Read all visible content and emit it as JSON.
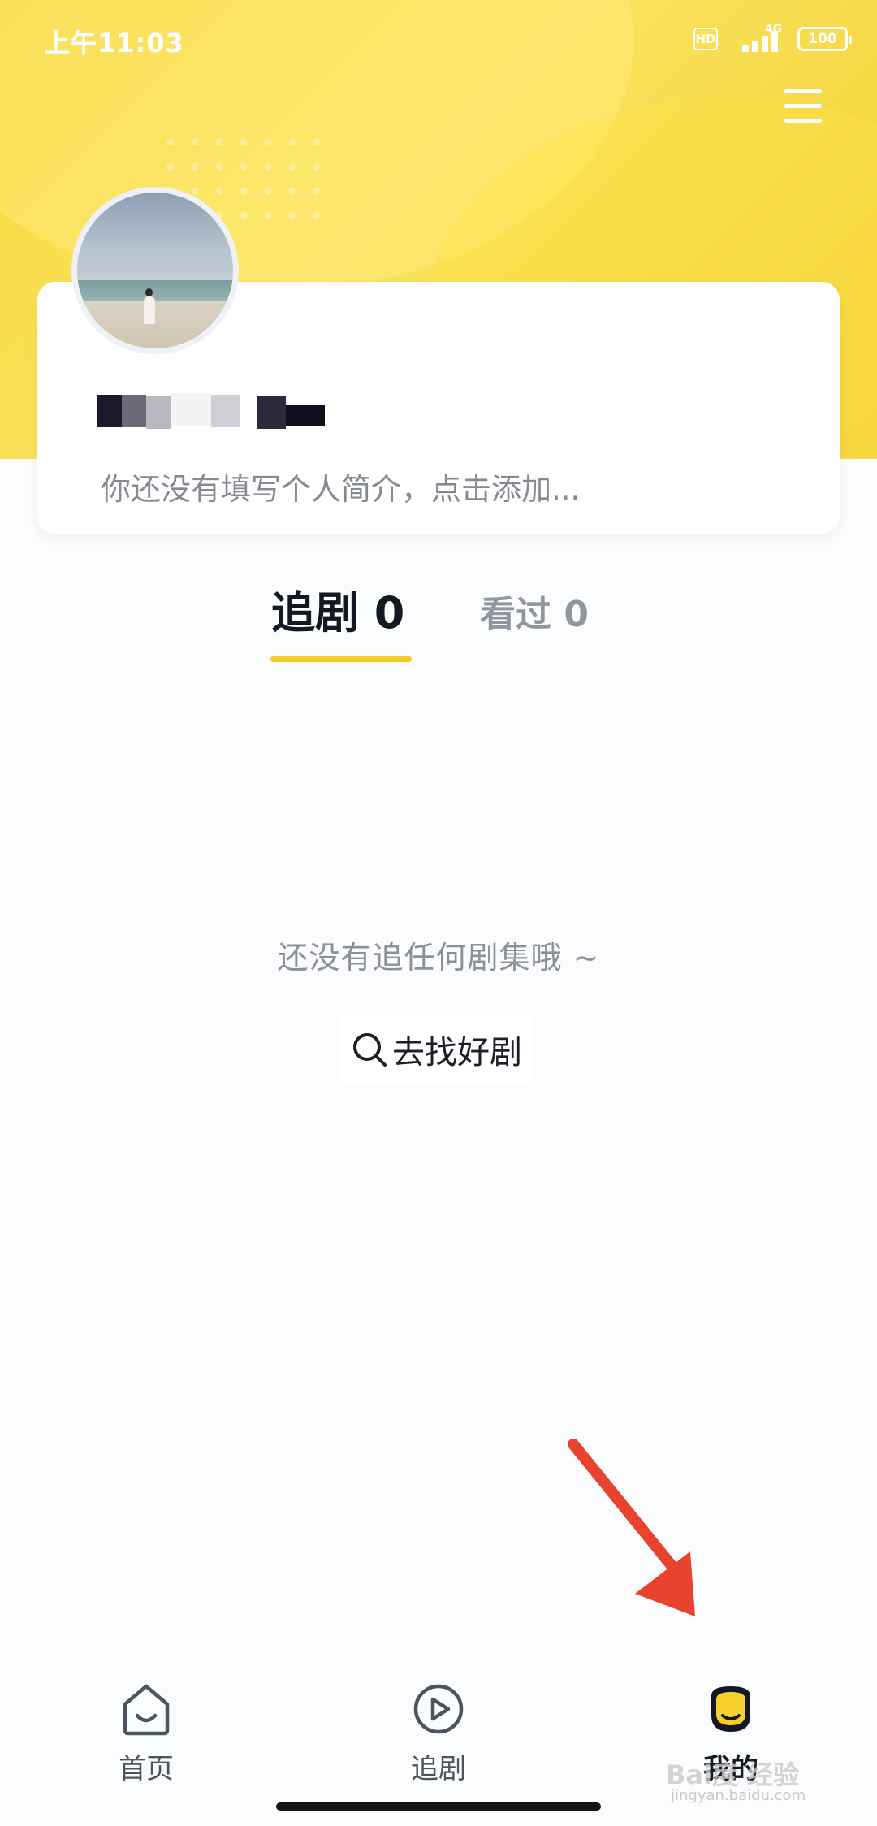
{
  "status_bar": {
    "time": "上午11:03",
    "hd": "HD",
    "network": "4G",
    "battery": "100"
  },
  "profile": {
    "bio_placeholder": "你还没有填写个人简介，点击添加..."
  },
  "tabs": [
    {
      "label": "追剧 0",
      "active": true
    },
    {
      "label": "看过 0",
      "active": false
    }
  ],
  "empty_state": {
    "message": "还没有追任何剧集哦 ~",
    "button_label": "去找好剧"
  },
  "bottom_nav": [
    {
      "label": "首页",
      "icon": "home-icon"
    },
    {
      "label": "追剧",
      "icon": "play-circle-icon"
    },
    {
      "label": "我的",
      "icon": "profile-icon",
      "active": true
    }
  ],
  "watermark": {
    "text": "Bai度 经验",
    "url": "jingyan.baidu.com"
  },
  "colors": {
    "header_yellow": "#f8d83d",
    "accent": "#f2cb2f",
    "arrow": "#e8432e"
  }
}
